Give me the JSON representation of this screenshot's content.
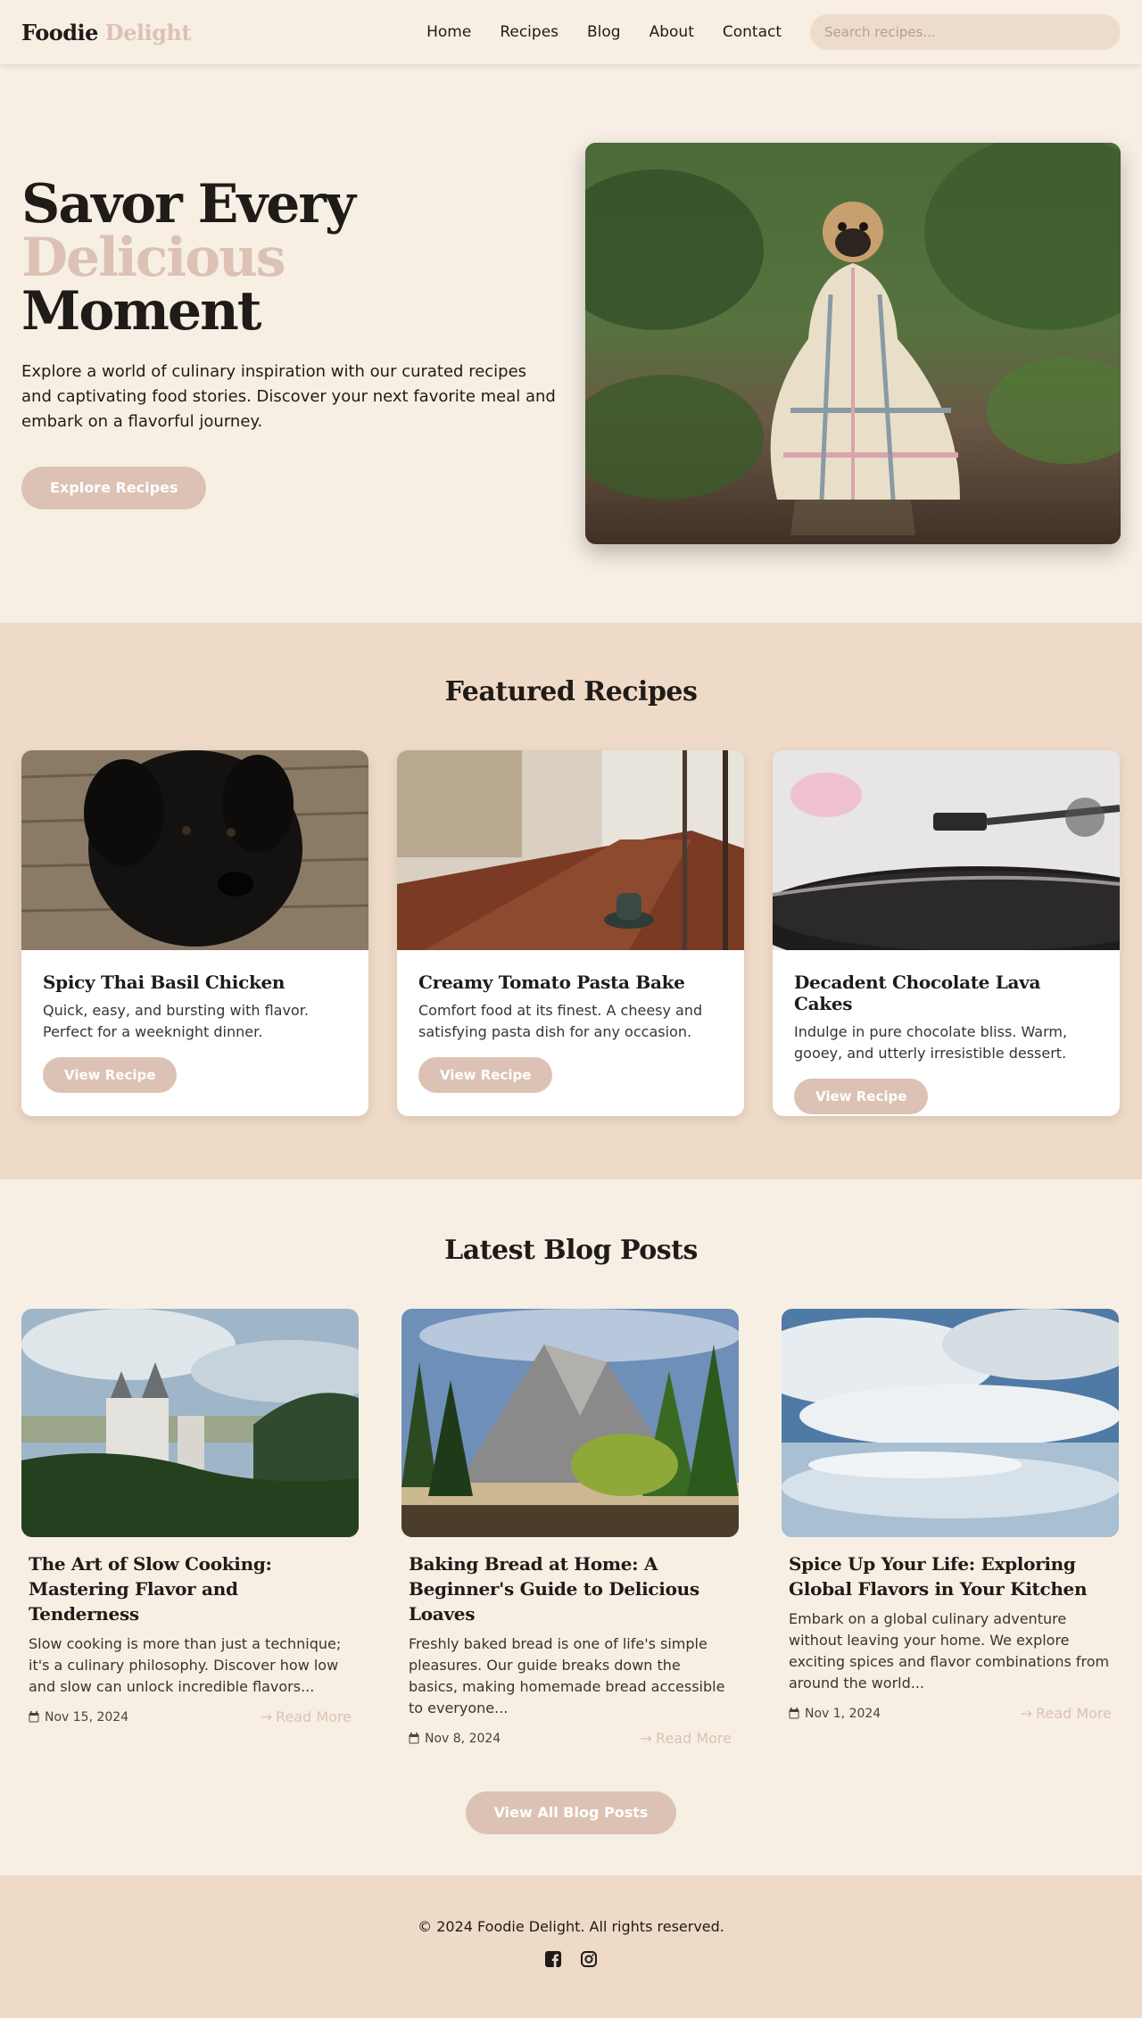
{
  "header": {
    "logo_part1": "Foodie",
    "logo_part2": "Delight",
    "nav": [
      "Home",
      "Recipes",
      "Blog",
      "About",
      "Contact"
    ],
    "search_placeholder": "Search recipes..."
  },
  "hero": {
    "title_line1": "Savor Every",
    "title_accent": "Delicious",
    "title_line2": "Moment",
    "subtitle": "Explore a world of culinary inspiration with our curated recipes and captivating food stories. Discover your next favorite meal and embark on a flavorful journey.",
    "cta": "Explore Recipes",
    "image_alt": "pug wrapped in plaid blanket in forest"
  },
  "featured": {
    "heading": "Featured Recipes",
    "cards": [
      {
        "title": "Spicy Thai Basil Chicken",
        "desc": "Quick, easy, and bursting with flavor. Perfect for a weeknight dinner.",
        "button": "View Recipe",
        "image": "black-puppy-on-wood"
      },
      {
        "title": "Creamy Tomato Pasta Bake",
        "desc": "Comfort food at its finest. A cheesy and satisfying pasta dish for any occasion.",
        "button": "View Recipe",
        "image": "cafe-table-with-coffee"
      },
      {
        "title": "Decadent Chocolate Lava Cakes",
        "desc": "Indulge in pure chocolate bliss. Warm, gooey, and utterly irresistible dessert.",
        "button": "View Recipe",
        "image": "record-player-turntable"
      }
    ]
  },
  "blog": {
    "heading": "Latest Blog Posts",
    "posts": [
      {
        "title": "The Art of Slow Cooking: Mastering Flavor and Tenderness",
        "excerpt": "Slow cooking is more than just a technique; it's a culinary philosophy. Discover how low and slow can unlock incredible flavors...",
        "date": "Nov 15, 2024",
        "read_more": "Read More",
        "image": "castle-on-forested-hill"
      },
      {
        "title": "Baking Bread at Home: A Beginner's Guide to Delicious Loaves",
        "excerpt": "Freshly baked bread is one of life's simple pleasures. Our guide breaks down the basics, making homemade bread accessible to everyone...",
        "date": "Nov 8, 2024",
        "read_more": "Read More",
        "image": "mountain-valley-forest"
      },
      {
        "title": "Spice Up Your Life: Exploring Global Flavors in Your Kitchen",
        "excerpt": "Embark on a global culinary adventure without leaving your home. We explore exciting spices and flavor combinations from around the world...",
        "date": "Nov 1, 2024",
        "read_more": "Read More",
        "image": "cloudy-sky-salt-flat"
      }
    ],
    "cta": "View All Blog Posts"
  },
  "footer": {
    "copyright": "© 2024 Foodie Delight. All rights reserved.",
    "socials": [
      "facebook-icon",
      "instagram-icon"
    ]
  },
  "colors": {
    "accent": "#dcc2b4",
    "background": "#f7efe4",
    "section_bg": "#eedac6"
  }
}
